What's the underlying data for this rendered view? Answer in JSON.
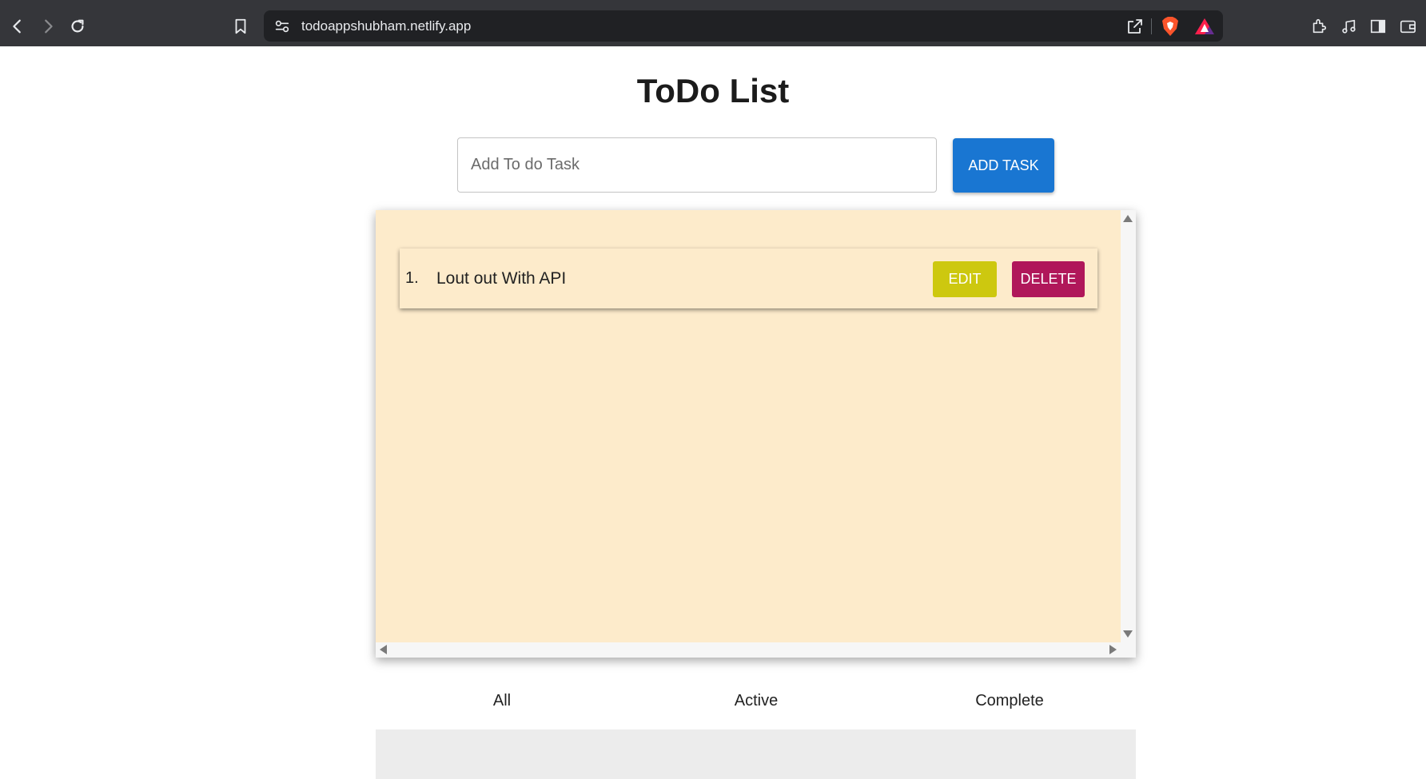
{
  "browser": {
    "url": "todoappshubham.netlify.app"
  },
  "app": {
    "title": "ToDo List",
    "input_placeholder": "Add To do Task",
    "add_button_label": "ADD TASK"
  },
  "tasks": [
    {
      "number": "1.",
      "text": "Lout out With API",
      "edit_label": "EDIT",
      "delete_label": "DELETE"
    }
  ],
  "filters": [
    "All",
    "Active",
    "Complete"
  ],
  "colors": {
    "panel_bg": "#fdebcb",
    "add_button": "#1976d2",
    "edit_button": "#cdc80f",
    "delete_button": "#b0175a",
    "browser_chrome": "#35363a"
  }
}
